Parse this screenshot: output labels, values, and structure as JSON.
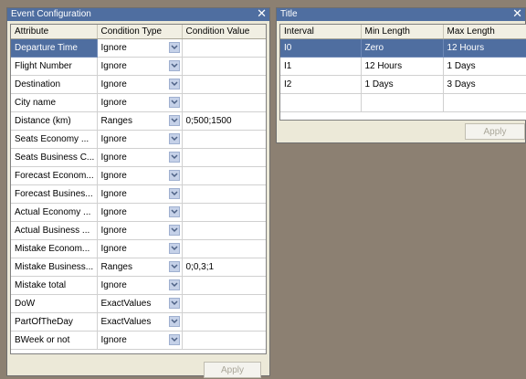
{
  "event_panel": {
    "title": "Event Configuration",
    "close_glyph": "✕",
    "columns": [
      "Attribute",
      "Condition Type",
      "Condition Value"
    ],
    "rows": [
      {
        "attribute": "Departure Time",
        "condition_type": "Ignore",
        "condition_value": ""
      },
      {
        "attribute": "Flight Number",
        "condition_type": "Ignore",
        "condition_value": ""
      },
      {
        "attribute": "Destination",
        "condition_type": "Ignore",
        "condition_value": ""
      },
      {
        "attribute": "City name",
        "condition_type": "Ignore",
        "condition_value": ""
      },
      {
        "attribute": "Distance (km)",
        "condition_type": "Ranges",
        "condition_value": "0;500;1500"
      },
      {
        "attribute": "Seats Economy ...",
        "condition_type": "Ignore",
        "condition_value": ""
      },
      {
        "attribute": "Seats Business C...",
        "condition_type": "Ignore",
        "condition_value": ""
      },
      {
        "attribute": "Forecast Econom...",
        "condition_type": "Ignore",
        "condition_value": ""
      },
      {
        "attribute": "Forecast Busines...",
        "condition_type": "Ignore",
        "condition_value": ""
      },
      {
        "attribute": "Actual Economy ...",
        "condition_type": "Ignore",
        "condition_value": ""
      },
      {
        "attribute": "Actual Business ...",
        "condition_type": "Ignore",
        "condition_value": ""
      },
      {
        "attribute": "Mistake Econom...",
        "condition_type": "Ignore",
        "condition_value": ""
      },
      {
        "attribute": "Mistake Business...",
        "condition_type": "Ranges",
        "condition_value": "0;0,3;1"
      },
      {
        "attribute": "Mistake total",
        "condition_type": "Ignore",
        "condition_value": ""
      },
      {
        "attribute": "DoW",
        "condition_type": "ExactValues",
        "condition_value": ""
      },
      {
        "attribute": "PartOfTheDay",
        "condition_type": "ExactValues",
        "condition_value": ""
      },
      {
        "attribute": "BWeek or not",
        "condition_type": "Ignore",
        "condition_value": ""
      }
    ],
    "apply_label": "Apply"
  },
  "title_panel": {
    "title": "Title",
    "close_glyph": "✕",
    "columns": [
      "Interval",
      "Min Length",
      "Max Length"
    ],
    "rows": [
      {
        "interval": "I0",
        "min_length": "Zero",
        "max_length": "12 Hours"
      },
      {
        "interval": "I1",
        "min_length": "12 Hours",
        "max_length": "1 Days"
      },
      {
        "interval": "I2",
        "min_length": "1 Days",
        "max_length": "3 Days"
      },
      {
        "interval": "",
        "min_length": "",
        "max_length": ""
      }
    ],
    "apply_label": "Apply"
  },
  "colors": {
    "desktop": "#8c8072",
    "title_bar": "#4f6ea0",
    "selection": "#4f6ea0",
    "panel": "#ece9d8"
  }
}
